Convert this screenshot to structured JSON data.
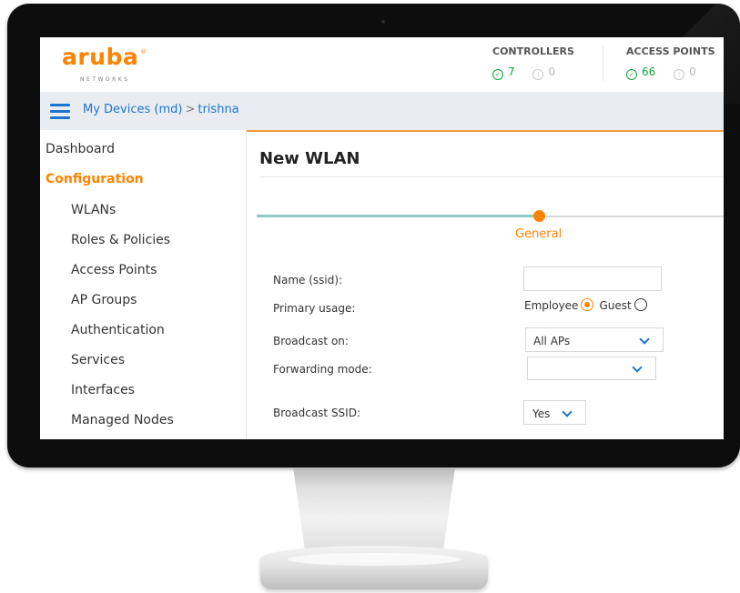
{
  "brand": {
    "name": "aruba",
    "subtitle": "NETWORKS",
    "accent": "#ff8300"
  },
  "header": {
    "controllers": {
      "label": "CONTROLLERS",
      "ok": "7",
      "down": "0"
    },
    "access_points": {
      "label": "ACCESS POINTS",
      "ok": "66",
      "down": "0"
    }
  },
  "breadcrumb": {
    "root": "My Devices (md)",
    "separator": ">",
    "current": "trishna"
  },
  "sidebar": {
    "items": [
      {
        "label": "Dashboard"
      },
      {
        "label": "Configuration"
      },
      {
        "label": "WLANs"
      },
      {
        "label": "Roles & Policies"
      },
      {
        "label": "Access Points"
      },
      {
        "label": "AP Groups"
      },
      {
        "label": "Authentication"
      },
      {
        "label": "Services"
      },
      {
        "label": "Interfaces"
      },
      {
        "label": "Managed Nodes"
      }
    ]
  },
  "main": {
    "title": "New WLAN",
    "step": "General",
    "form": {
      "name_label": "Name (ssid):",
      "name_value": "",
      "usage_label": "Primary usage:",
      "usage_options": [
        "Employee",
        "Guest"
      ],
      "usage_selected": "Employee",
      "broadcast_on_label": "Broadcast on:",
      "broadcast_on_value": "All APs",
      "forwarding_label": "Forwarding mode:",
      "forwarding_value": "",
      "broadcast_ssid_label": "Broadcast SSID:",
      "broadcast_ssid_value": "Yes"
    }
  },
  "colors": {
    "accent_orange": "#ff8300",
    "link_blue": "#1b75d0",
    "ok_green": "#11a63a",
    "progress_teal": "#8ecac4"
  }
}
